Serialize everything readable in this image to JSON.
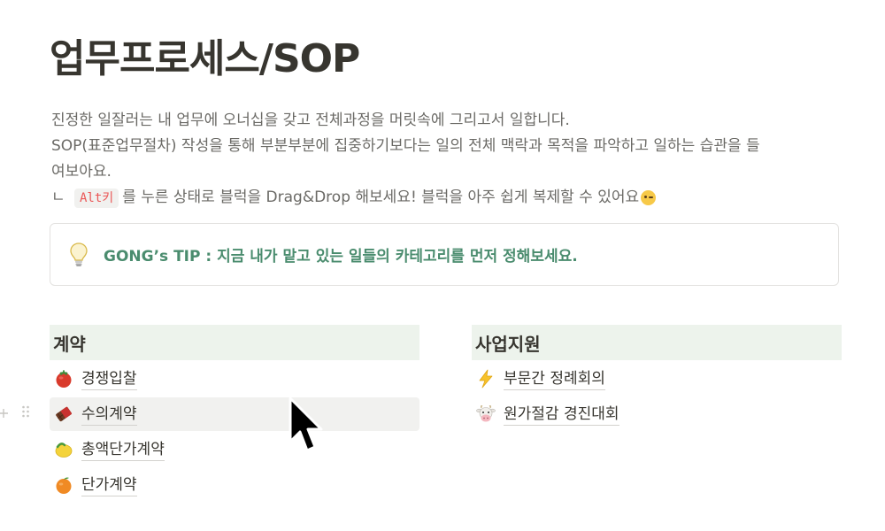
{
  "page": {
    "title": "업무프로세스/SOP",
    "description": {
      "line1": "진정한 일잘러는 내 업무에 오너십을 갖고 전체과정을 머릿속에 그리고서 일합니다.",
      "line2": "SOP(표준업무절차) 작성을 통해 부분부분에 집중하기보다는 일의 전체 맥락과 목적을 파악하고 일하는 습관을 들",
      "line3": "여보아요.",
      "line4_prefix": "ㄴ",
      "line4_key": "Alt키",
      "line4_text": "를 누른 상태로 블럭을 Drag&Drop 해보세요! 블럭을 아주 쉽게 복제할 수 있어요"
    },
    "callout": {
      "icon": "lightbulb-icon",
      "text": "GONG’s TIP : 지금 내가 맡고 있는 일들의 카테고리를 먼저 정해보세요."
    }
  },
  "columns": [
    {
      "header": "계약",
      "items": [
        {
          "icon": "tomato-icon",
          "label": "경쟁입찰"
        },
        {
          "icon": "chocolate-icon",
          "label": "수의계약"
        },
        {
          "icon": "lemon-icon",
          "label": "총액단가계약"
        },
        {
          "icon": "tangerine-icon",
          "label": "단가계약"
        }
      ]
    },
    {
      "header": "사업지원",
      "items": [
        {
          "icon": "lightning-icon",
          "label": "부문간 정례회의"
        },
        {
          "icon": "cow-face-icon",
          "label": "원가절감 경진대회"
        }
      ]
    }
  ],
  "colors": {
    "callout_text": "#4a8c6e",
    "header_bg": "#edf3ec",
    "inline_code": "#eb5757"
  }
}
